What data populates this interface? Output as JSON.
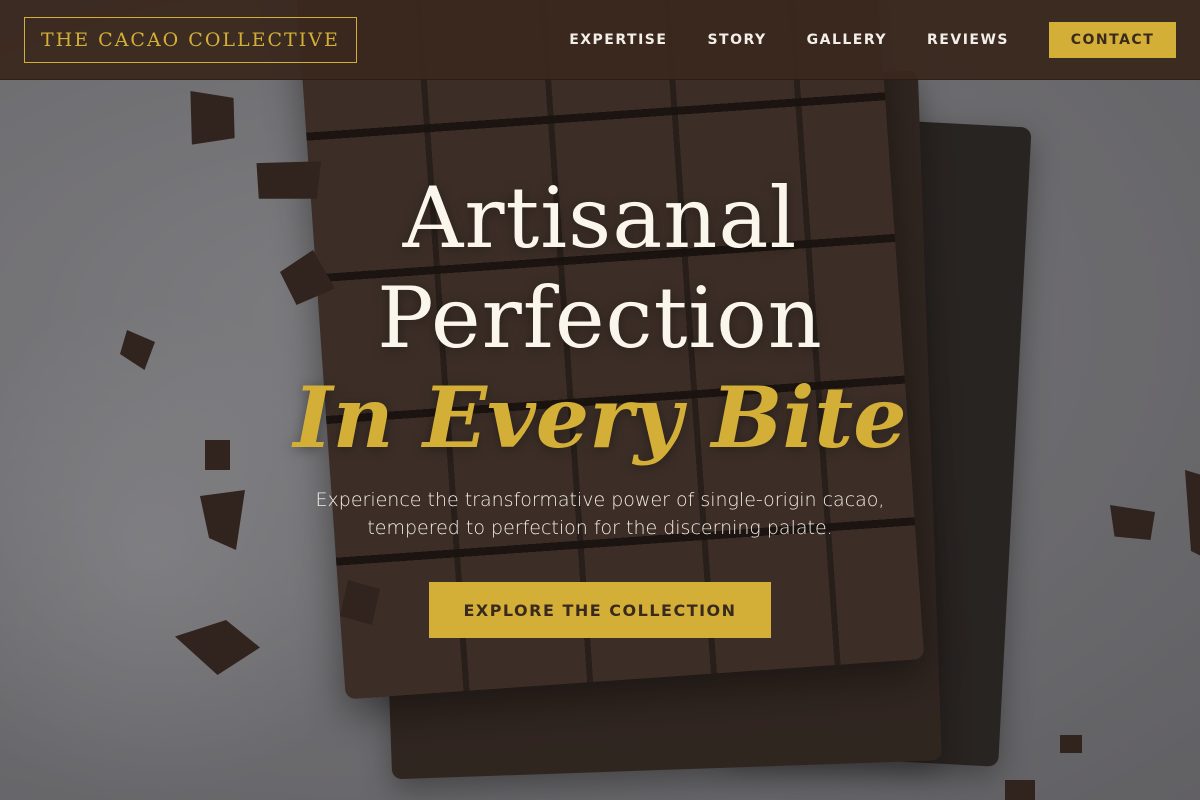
{
  "header": {
    "brand": "THE CACAO COLLECTIVE",
    "nav": [
      {
        "label": "EXPERTISE"
      },
      {
        "label": "STORY"
      },
      {
        "label": "GALLERY"
      },
      {
        "label": "REVIEWS"
      }
    ],
    "contact_label": "CONTACT"
  },
  "hero": {
    "title_line1": "Artisanal",
    "title_line2": "Perfection",
    "title_accent": "In Every Bite",
    "tagline_line1": "Experience the transformative power of single-origin cacao,",
    "tagline_line2": "tempered to perfection for the discerning palate.",
    "cta_label": "EXPLORE THE COLLECTION"
  },
  "colors": {
    "accent_gold": "#d4af37",
    "header_brown": "#3a281e",
    "text_cream": "#fbf6ec"
  }
}
